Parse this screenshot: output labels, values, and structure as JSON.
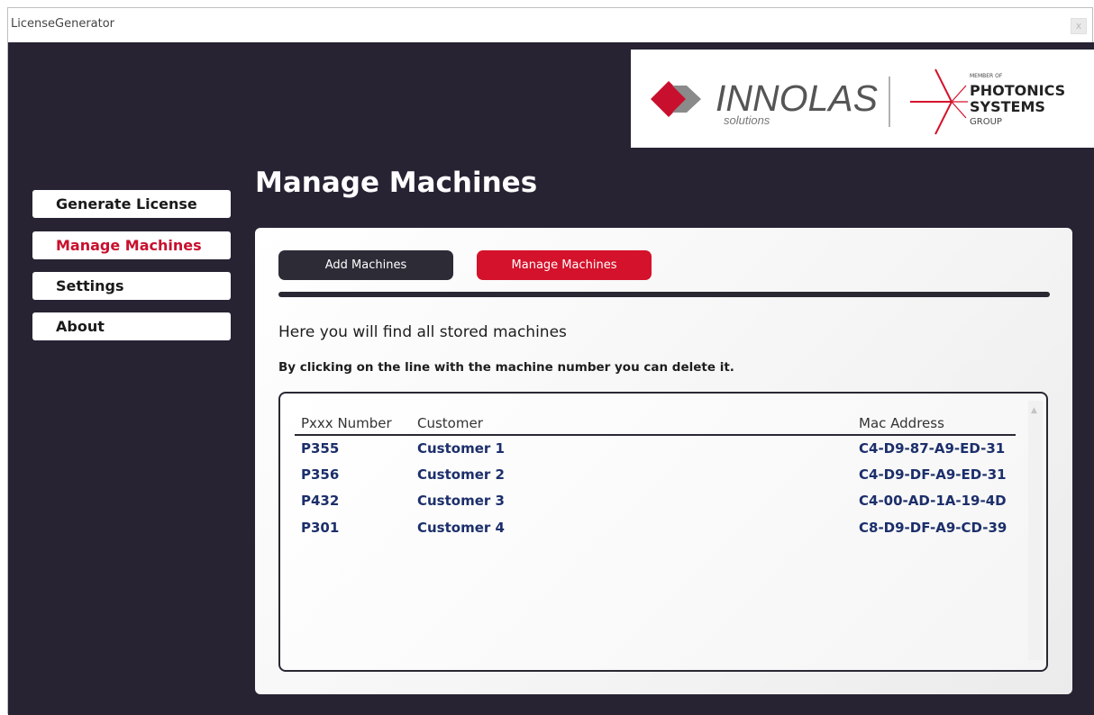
{
  "window": {
    "title": "LicenseGenerator",
    "close_label": "x"
  },
  "logo": {
    "brand": "INNOLAS",
    "brand_sub": "solutions",
    "member_of": "MEMBER OF",
    "group_line1": "PHOTONICS",
    "group_line2": "SYSTEMS",
    "group_line3": "GROUP",
    "accent_color": "#c8102e"
  },
  "nav": {
    "items": [
      {
        "label": "Generate License"
      },
      {
        "label": "Manage Machines"
      },
      {
        "label": "Settings"
      },
      {
        "label": "About"
      }
    ],
    "active_index": 1
  },
  "page": {
    "title": "Manage Machines"
  },
  "tabs": {
    "add_label": "Add Machines",
    "manage_label": "Manage Machines"
  },
  "info": {
    "heading": "Here you will find all stored machines",
    "subtext": "By clicking on the line with the machine number you can delete it."
  },
  "table": {
    "headers": [
      "Pxxx Number",
      "Customer",
      "Mac Address"
    ],
    "rows": [
      {
        "number": "P355",
        "customer": "Customer 1",
        "mac": "C4-D9-87-A9-ED-31"
      },
      {
        "number": "P356",
        "customer": "Customer 2",
        "mac": "C4-D9-DF-A9-ED-31"
      },
      {
        "number": "P432",
        "customer": "Customer 3",
        "mac": "C4-00-AD-1A-19-4D"
      },
      {
        "number": "P301",
        "customer": "Customer 4",
        "mac": "C8-D9-DF-A9-CD-39"
      }
    ]
  },
  "colors": {
    "background": "#272333",
    "accent_red": "#d4122b",
    "dark_button": "#2c2b36",
    "table_text": "#1c2f6b"
  }
}
